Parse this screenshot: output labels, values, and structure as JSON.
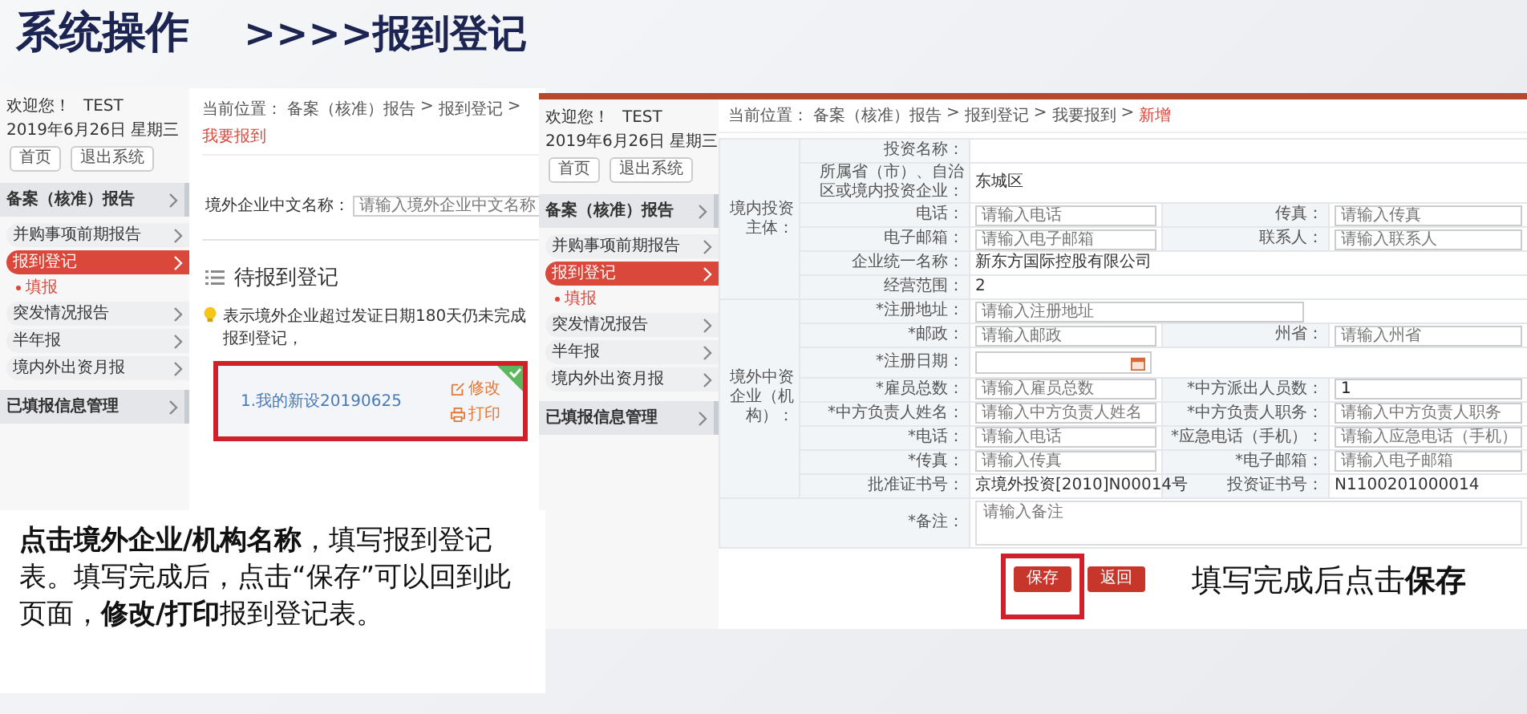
{
  "slide_title": {
    "heading": "系统操作",
    "subheading": ">>>>报到登记"
  },
  "list_screen": {
    "sidebar": {
      "welcome": "欢迎您！",
      "user": "TEST",
      "date": "2019年6月26日 星期三",
      "buttons": [
        "首页",
        "退出系统"
      ],
      "sections": [
        {
          "label": "备案（核准）报告",
          "items": [
            {
              "label": "并购事项前期报告",
              "selected": false
            },
            {
              "label": "报到登记",
              "selected": true,
              "children": [
                {
                  "label": "填报",
                  "selected": true
                }
              ]
            },
            {
              "label": "突发情况报告",
              "selected": false
            },
            {
              "label": "半年报",
              "selected": false
            },
            {
              "label": "境内外出资月报",
              "selected": false
            }
          ]
        },
        {
          "label": "已填报信息管理"
        }
      ]
    },
    "breadcrumb": {
      "prefix": "当前位置：",
      "separator": ">",
      "path": [
        {
          "label": "备案（核准）报告",
          "current": false
        },
        {
          "label": "报到登记",
          "current": false
        },
        {
          "label": "我要报到",
          "current": true
        }
      ]
    },
    "search": {
      "label": "境外企业中文名称：",
      "placeholder": "请输入境外企业中文名称"
    },
    "section_title": "待报到登记",
    "notice": "表示境外企业超过发证日期180天仍未完成报到登记，",
    "cards": [
      {
        "title": "1.我的新设20190625",
        "checked": true,
        "highlighted": true,
        "actions": [
          {
            "label": "修改",
            "kind": "edit"
          },
          {
            "label": "打印",
            "kind": "print"
          }
        ]
      }
    ]
  },
  "form_screen": {
    "sidebar": {
      "welcome": "欢迎您！",
      "user": "TEST",
      "date": "2019年6月26日 星期三",
      "buttons": [
        "首页",
        "退出系统"
      ],
      "sections": [
        {
          "label": "备案（核准）报告",
          "items": [
            {
              "label": "并购事项前期报告",
              "selected": false
            },
            {
              "label": "报到登记",
              "selected": true,
              "children": [
                {
                  "label": "填报",
                  "selected": true
                }
              ]
            },
            {
              "label": "突发情况报告",
              "selected": false
            },
            {
              "label": "半年报",
              "selected": false
            },
            {
              "label": "境内外出资月报",
              "selected": false
            }
          ]
        },
        {
          "label": "已填报信息管理"
        }
      ]
    },
    "breadcrumb": {
      "prefix": "当前位置：",
      "separator": ">",
      "path": [
        {
          "label": "备案（核准）报告",
          "current": false
        },
        {
          "label": "报到登记",
          "current": false
        },
        {
          "label": "我要报到",
          "current": false
        },
        {
          "label": "新增",
          "current": true
        }
      ]
    },
    "groups": [
      {
        "label": "境内投资主体：",
        "rows": [
          [
            {
              "label": "投资名称：",
              "kind": "text"
            }
          ],
          [
            {
              "label": "所属省（市）、自治区或境内投资企业：",
              "kind": "text",
              "value": "东城区"
            }
          ],
          [
            {
              "label": "电话：",
              "kind": "input",
              "placeholder": "请输入电话"
            },
            {
              "label": "传真：",
              "kind": "input",
              "placeholder": "请输入传真"
            }
          ],
          [
            {
              "label": "电子邮箱：",
              "kind": "input",
              "placeholder": "请输入电子邮箱"
            },
            {
              "label": "联系人：",
              "kind": "input",
              "placeholder": "请输入联系人"
            }
          ],
          [
            {
              "label": "企业统一名称：",
              "kind": "text",
              "value": "新东方国际控股有限公司"
            }
          ],
          [
            {
              "label": "经营范围：",
              "kind": "text",
              "value": "2"
            }
          ]
        ]
      },
      {
        "label": "境外中资企业（机构）：",
        "rows": [
          [
            {
              "label": "*注册地址：",
              "kind": "input",
              "placeholder": "请输入注册地址"
            }
          ],
          [
            {
              "label": "*邮政：",
              "kind": "input",
              "placeholder": "请输入邮政"
            },
            {
              "label": "州省：",
              "kind": "input",
              "placeholder": "请输入州省"
            }
          ],
          [
            {
              "label": "*注册日期：",
              "kind": "date"
            }
          ],
          [
            {
              "label": "*雇员总数：",
              "kind": "input",
              "placeholder": "请输入雇员总数"
            },
            {
              "label": "*中方派出人员数：",
              "kind": "input",
              "value": "1"
            }
          ],
          [
            {
              "label": "*中方负责人姓名：",
              "kind": "input",
              "placeholder": "请输入中方负责人姓名"
            },
            {
              "label": "*中方负责人职务：",
              "kind": "input",
              "placeholder": "请输入中方负责人职务"
            }
          ],
          [
            {
              "label": "*电话：",
              "kind": "input",
              "placeholder": "请输入电话"
            },
            {
              "label": "*应急电话（手机）：",
              "kind": "input",
              "placeholder": "请输入应急电话（手机）"
            }
          ],
          [
            {
              "label": "*传真：",
              "kind": "input",
              "placeholder": "请输入传真"
            },
            {
              "label": "*电子邮箱：",
              "kind": "input",
              "placeholder": "请输入电子邮箱"
            }
          ],
          [
            {
              "label": "批准证书号：",
              "kind": "text",
              "value": "京境外投资[2010]N00014号"
            },
            {
              "label": "投资证书号：",
              "kind": "text",
              "value": "N1100201000014"
            }
          ]
        ]
      }
    ],
    "remark": {
      "label": "*备注：",
      "placeholder": "请输入备注"
    },
    "buttons": [
      {
        "label": "保存",
        "highlighted": true
      },
      {
        "label": "返回",
        "highlighted": false
      }
    ]
  },
  "captions": [
    {
      "kind": "panel",
      "text": "**点击境外企业/机构名称**，填写报到登记表。填写完成后，点击“保存”可以回到此页面，**修改/打印**报到登记表。"
    },
    {
      "kind": "banner",
      "text": "填写完成后点击**保存**"
    }
  ]
}
